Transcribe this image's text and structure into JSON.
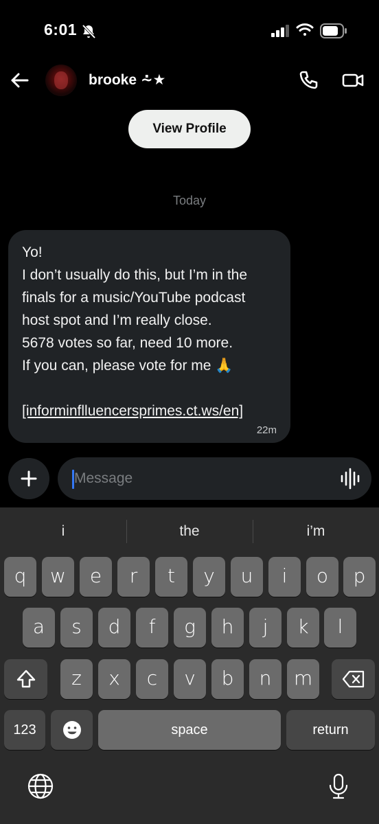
{
  "status_bar": {
    "time": "6:01",
    "icons": [
      "bell-slash-icon",
      "signal-icon",
      "wifi-icon",
      "battery-icon"
    ]
  },
  "header": {
    "contact_name": "brooke ⩪★",
    "icons": [
      "back-arrow-icon",
      "phone-icon",
      "video-camera-icon"
    ]
  },
  "view_profile_label": "View Profile",
  "date_label": "Today",
  "message": {
    "lines": [
      "Yo!",
      "I don’t usually do this, but I’m in the",
      "finals for a music/YouTube podcast",
      "host spot and I’m really close.",
      "5678 votes so far, need 10 more.",
      "If you can, please vote for me 🙏",
      ""
    ],
    "link": "[informinflluencersprimes.ct.ws/en]",
    "time": "22m"
  },
  "composer": {
    "placeholder": "Message",
    "icons": [
      "plus-icon",
      "voice-waveform-icon"
    ]
  },
  "keyboard": {
    "suggestions": [
      "i",
      "the",
      "i’m"
    ],
    "row1": [
      "q",
      "w",
      "e",
      "r",
      "t",
      "y",
      "u",
      "i",
      "o",
      "p"
    ],
    "row2": [
      "a",
      "s",
      "d",
      "f",
      "g",
      "h",
      "j",
      "k",
      "l"
    ],
    "row3": [
      "z",
      "x",
      "c",
      "v",
      "b",
      "n",
      "m"
    ],
    "numbers_label": "123",
    "space_label": "space",
    "return_label": "return",
    "icons": [
      "shift-icon",
      "delete-icon",
      "emoji-icon",
      "globe-icon",
      "microphone-icon"
    ]
  },
  "colors": {
    "background": "#000000",
    "bubble": "#202326",
    "keyboard": "#2b2b2b",
    "key": "#6b6b6b",
    "caret": "#3478f6"
  }
}
